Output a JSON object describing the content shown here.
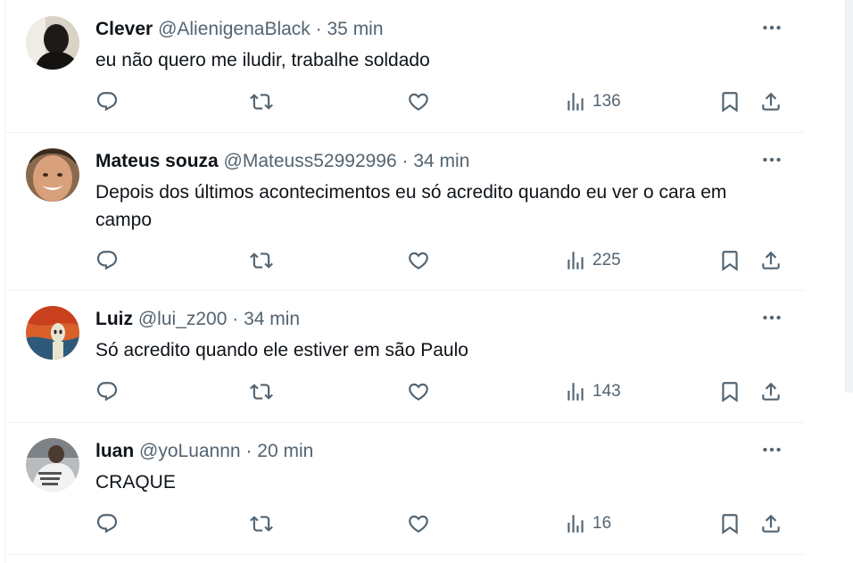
{
  "tweets": [
    {
      "name": "Clever",
      "handle": "@AlienigenaBlack",
      "sep": "·",
      "time": "35 min",
      "text": "eu não quero me iludir, trabalhe soldado",
      "views": "136"
    },
    {
      "name": "Mateus souza",
      "handle": "@Mateuss52992996",
      "sep": "·",
      "time": "34 min",
      "text": "Depois dos últimos acontecimentos eu só acredito quando eu ver o cara em campo",
      "views": "225"
    },
    {
      "name": "Luiz",
      "handle": "@lui_z200",
      "sep": "·",
      "time": "34 min",
      "text": "Só acredito quando ele estiver em são Paulo",
      "views": "143"
    },
    {
      "name": "luan",
      "handle": "@yoLuannn",
      "sep": "·",
      "time": "20 min",
      "text": "CRAQUE",
      "views": "16"
    }
  ],
  "icons": {
    "more": "more-icon",
    "reply": "reply-icon",
    "retweet": "retweet-icon",
    "like": "like-icon",
    "views": "views-icon",
    "bookmark": "bookmark-icon",
    "share": "share-icon"
  },
  "colors": {
    "secondary_text": "#536471",
    "primary_text": "#0f1419",
    "divider": "#eff3f4"
  }
}
